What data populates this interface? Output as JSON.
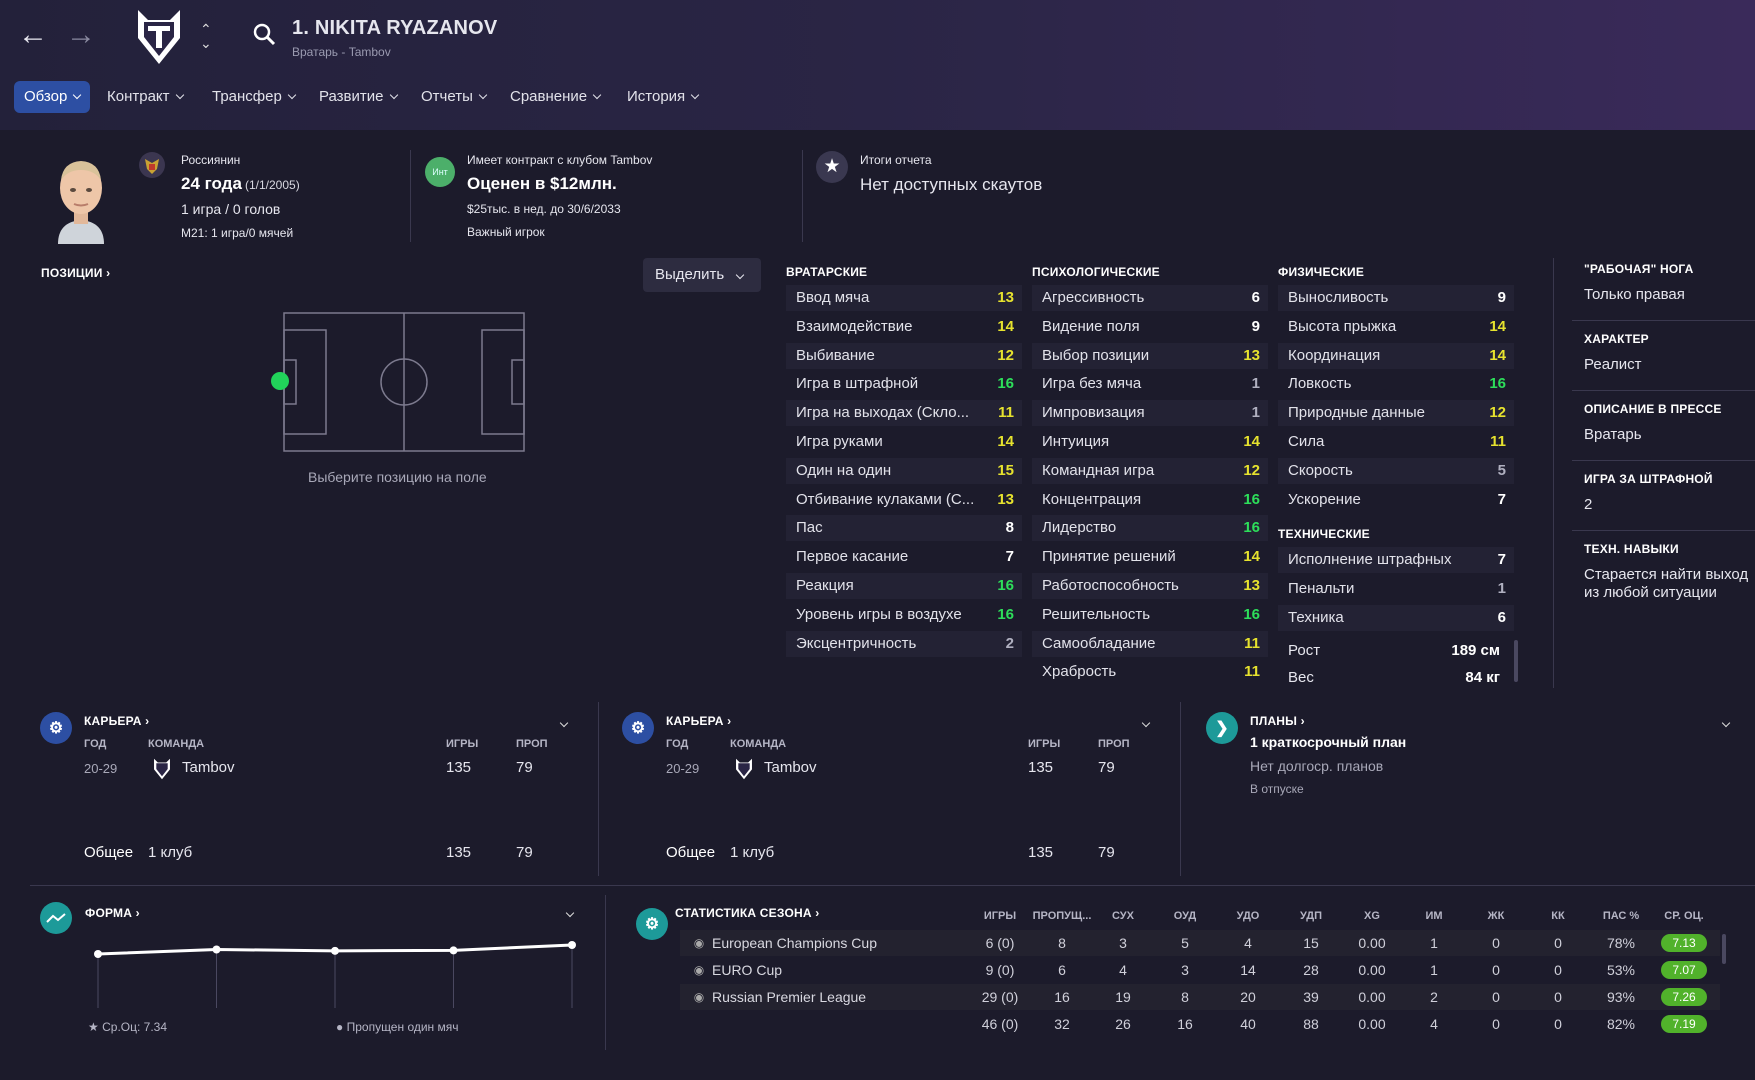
{
  "header": {
    "player_title": "1. NIKITA RYAZANOV",
    "player_subtitle": "Вратарь - Tambov",
    "tabs": [
      "Обзор",
      "Контракт",
      "Трансфер",
      "Развитие",
      "Отчеты",
      "Сравнение",
      "История"
    ]
  },
  "summary": {
    "nationality": "Россиянин",
    "age": "24 года",
    "dob": "(1/1/2005)",
    "apps_goals": "1 игра / 0 голов",
    "u21": "М21: 1 игра/0 мячей",
    "contract_badge": "Инт",
    "contract_club": "Имеет контракт с клубом Tambov",
    "value": "Оценен в $12млн.",
    "wage": "$25тыс. в нед. до 30/6/2033",
    "role": "Важный игрок",
    "report_title": "Итоги отчета",
    "report_text": "Нет доступных скаутов"
  },
  "positions": {
    "header": "ПОЗИЦИИ",
    "highlight_label": "Выделить",
    "hint": "Выберите позицию на поле"
  },
  "attributes": {
    "gk_header": "ВРАТАРСКИЕ",
    "mental_header": "ПСИХОЛОГИЧЕСКИЕ",
    "physical_header": "ФИЗИЧЕСКИЕ",
    "technical_header": "ТЕХНИЧЕСКИЕ",
    "goalkeeping": [
      {
        "name": "Ввод мяча",
        "value": "13",
        "c": "y"
      },
      {
        "name": "Взаимодействие",
        "value": "14",
        "c": "y"
      },
      {
        "name": "Выбивание",
        "value": "12",
        "c": "y"
      },
      {
        "name": "Игра в штрафной",
        "value": "16",
        "c": "g"
      },
      {
        "name": "Игра на выходах (Скло...",
        "value": "11",
        "c": "y"
      },
      {
        "name": "Игра руками",
        "value": "14",
        "c": "y"
      },
      {
        "name": "Один на один",
        "value": "15",
        "c": "y"
      },
      {
        "name": "Отбивание кулаками (С...",
        "value": "13",
        "c": "y"
      },
      {
        "name": "Пас",
        "value": "8",
        "c": "w"
      },
      {
        "name": "Первое касание",
        "value": "7",
        "c": "w"
      },
      {
        "name": "Реакция",
        "value": "16",
        "c": "g"
      },
      {
        "name": "Уровень игры в воздухе",
        "value": "16",
        "c": "g"
      },
      {
        "name": "Эксцентричность",
        "value": "2",
        "c": "gr"
      }
    ],
    "mental": [
      {
        "name": "Агрессивность",
        "value": "6",
        "c": "w"
      },
      {
        "name": "Видение поля",
        "value": "9",
        "c": "w"
      },
      {
        "name": "Выбор позиции",
        "value": "13",
        "c": "y"
      },
      {
        "name": "Игра без мяча",
        "value": "1",
        "c": "gr"
      },
      {
        "name": "Импровизация",
        "value": "1",
        "c": "gr"
      },
      {
        "name": "Интуиция",
        "value": "14",
        "c": "y"
      },
      {
        "name": "Командная игра",
        "value": "12",
        "c": "y"
      },
      {
        "name": "Концентрация",
        "value": "16",
        "c": "g"
      },
      {
        "name": "Лидерство",
        "value": "16",
        "c": "g"
      },
      {
        "name": "Принятие решений",
        "value": "14",
        "c": "y"
      },
      {
        "name": "Работоспособность",
        "value": "13",
        "c": "y"
      },
      {
        "name": "Решительность",
        "value": "16",
        "c": "g"
      },
      {
        "name": "Самообладание",
        "value": "11",
        "c": "y"
      },
      {
        "name": "Храбрость",
        "value": "11",
        "c": "y"
      }
    ],
    "physical": [
      {
        "name": "Выносливость",
        "value": "9",
        "c": "w"
      },
      {
        "name": "Высота прыжка",
        "value": "14",
        "c": "y"
      },
      {
        "name": "Координация",
        "value": "14",
        "c": "y"
      },
      {
        "name": "Ловкость",
        "value": "16",
        "c": "g"
      },
      {
        "name": "Природные данные",
        "value": "12",
        "c": "y"
      },
      {
        "name": "Сила",
        "value": "11",
        "c": "y"
      },
      {
        "name": "Скорость",
        "value": "5",
        "c": "gr"
      },
      {
        "name": "Ускорение",
        "value": "7",
        "c": "w"
      }
    ],
    "technical": [
      {
        "name": "Исполнение штрафных",
        "value": "7",
        "c": "w"
      },
      {
        "name": "Пенальти",
        "value": "1",
        "c": "gr"
      },
      {
        "name": "Техника",
        "value": "6",
        "c": "w"
      }
    ],
    "height_label": "Рост",
    "height": "189 см",
    "weight_label": "Вес",
    "weight": "84 кг"
  },
  "side_info": [
    {
      "label": "\"РАБОЧАЯ\" НОГА",
      "value": "Только правая"
    },
    {
      "label": "ХАРАКТЕР",
      "value": "Реалист"
    },
    {
      "label": "ОПИСАНИЕ В ПРЕССЕ",
      "value": "Вратарь"
    },
    {
      "label": "ИГРА ЗА ШТРАФНОЙ",
      "value": "2"
    },
    {
      "label": "ТЕХН. НАВЫКИ",
      "value": "Старается найти выход из любой ситуации"
    }
  ],
  "career": {
    "header": "КАРЬЕРА",
    "col_year": "ГОД",
    "col_team": "КОМАНДА",
    "col_apps": "ИГРЫ",
    "col_conc": "ПРОП",
    "row_year": "20-29",
    "row_team": "Tambov",
    "row_apps": "135",
    "row_conc": "79",
    "total_label": "Общее",
    "total_clubs": "1 клуб",
    "total_apps": "135",
    "total_conc": "79"
  },
  "plans": {
    "header": "ПЛАНЫ",
    "short": "1 краткосрочный план",
    "long": "Нет долгоср. планов",
    "status": "В отпуске"
  },
  "form": {
    "header": "ФОРМА",
    "avg": "Ср.Оц: 7.34",
    "note": "Пропущен один мяч"
  },
  "chart_data": {
    "type": "line",
    "x": [
      1,
      2,
      3,
      4,
      5
    ],
    "values": [
      7.2,
      7.3,
      7.27,
      7.28,
      7.4
    ],
    "ylim": [
      6.0,
      7.6
    ],
    "grid": true
  },
  "season_stats": {
    "header": "СТАТИСТИКА СЕЗОНА",
    "columns": [
      "ИГРЫ",
      "ПРОПУЩ...",
      "СУХ",
      "ОУД",
      "УДО",
      "УДП",
      "XG",
      "ИМ",
      "ЖК",
      "КК",
      "ПАС %",
      "СР. ОЦ."
    ],
    "rows": [
      {
        "comp": "European Champions Cup",
        "vals": [
          "6 (0)",
          "8",
          "3",
          "5",
          "4",
          "15",
          "0.00",
          "1",
          "0",
          "0",
          "78%"
        ],
        "rating": "7.13"
      },
      {
        "comp": "EURO Cup",
        "vals": [
          "9 (0)",
          "6",
          "4",
          "3",
          "14",
          "28",
          "0.00",
          "1",
          "0",
          "0",
          "53%"
        ],
        "rating": "7.07"
      },
      {
        "comp": "Russian Premier League",
        "vals": [
          "29 (0)",
          "16",
          "19",
          "8",
          "20",
          "39",
          "0.00",
          "2",
          "0",
          "0",
          "93%"
        ],
        "rating": "7.26"
      }
    ],
    "total": {
      "vals": [
        "46 (0)",
        "32",
        "26",
        "16",
        "40",
        "88",
        "0.00",
        "4",
        "0",
        "0",
        "82%"
      ],
      "rating": "7.19"
    }
  },
  "colors": {
    "accent": "#2d4fa3",
    "yellow": "#e6e22e",
    "green": "#2dde5a",
    "rating": "#51b22b"
  }
}
